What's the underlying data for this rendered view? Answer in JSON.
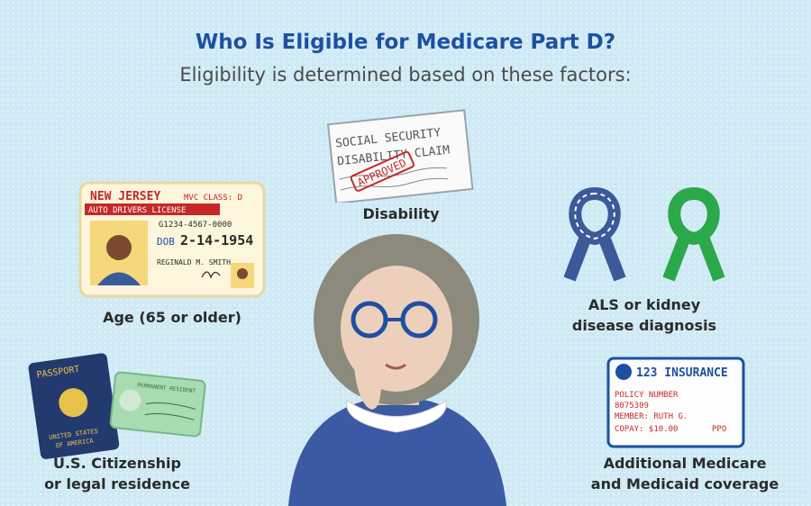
{
  "header": {
    "title": "Who Is Eligible for Medicare Part D?",
    "subtitle": "Eligibility is determined based on these factors:"
  },
  "factors": {
    "age": "Age (65 or older)",
    "disability": "Disability",
    "als_line1": "ALS or kidney",
    "als_line2": "disease diagnosis",
    "citizenship_line1": "U.S. Citizenship",
    "citizenship_line2": "or legal residence",
    "coverage_line1": "Additional Medicare",
    "coverage_line2": "and Medicaid coverage"
  },
  "license": {
    "state": "NEW JERSEY",
    "mvc": "MVC CLASS: D",
    "type": "AUTO DRIVERS LICENSE",
    "number": "G1234-4567-0000",
    "dob_label": "DOB",
    "dob": "2-14-1954",
    "name": "REGINALD M. SMITH"
  },
  "ssd_claim": {
    "line1": "SOCIAL SECURITY",
    "line2": "DISABILITY CLAIM",
    "stamp": "APPROVED"
  },
  "passport": {
    "title": "PASSPORT",
    "country_line1": "UNITED STATES",
    "country_line2": "OF AMERICA"
  },
  "green_card": {
    "title": "PERMANENT RESIDENT"
  },
  "insurance": {
    "company": "123 INSURANCE",
    "policy_label": "POLICY NUMBER",
    "policy_number": "8075309",
    "member": "MEMBER: RUTH G.",
    "copay": "COPAY: $10.00",
    "plan": "PPO"
  },
  "colors": {
    "title": "#1d4fa3",
    "background": "#cfeaf5",
    "als_ribbon": "#3a5a9a",
    "kidney_ribbon": "#2aa84a",
    "stamp": "#c62828"
  }
}
